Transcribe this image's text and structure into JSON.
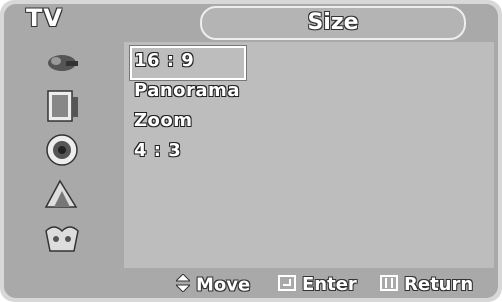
{
  "header": {
    "section_label": "TV",
    "title": "Size"
  },
  "sidebar": {
    "items": [
      {
        "name": "picture-icon"
      },
      {
        "name": "sound-icon"
      },
      {
        "name": "channel-icon"
      },
      {
        "name": "setup-icon"
      },
      {
        "name": "input-icon"
      }
    ]
  },
  "options": [
    {
      "label": "16 : 9",
      "selected": true
    },
    {
      "label": "Panorama",
      "selected": false
    },
    {
      "label": "Zoom",
      "selected": false
    },
    {
      "label": "4 : 3",
      "selected": false
    }
  ],
  "footer": {
    "move_label": "Move",
    "enter_label": "Enter",
    "return_label": "Return"
  }
}
